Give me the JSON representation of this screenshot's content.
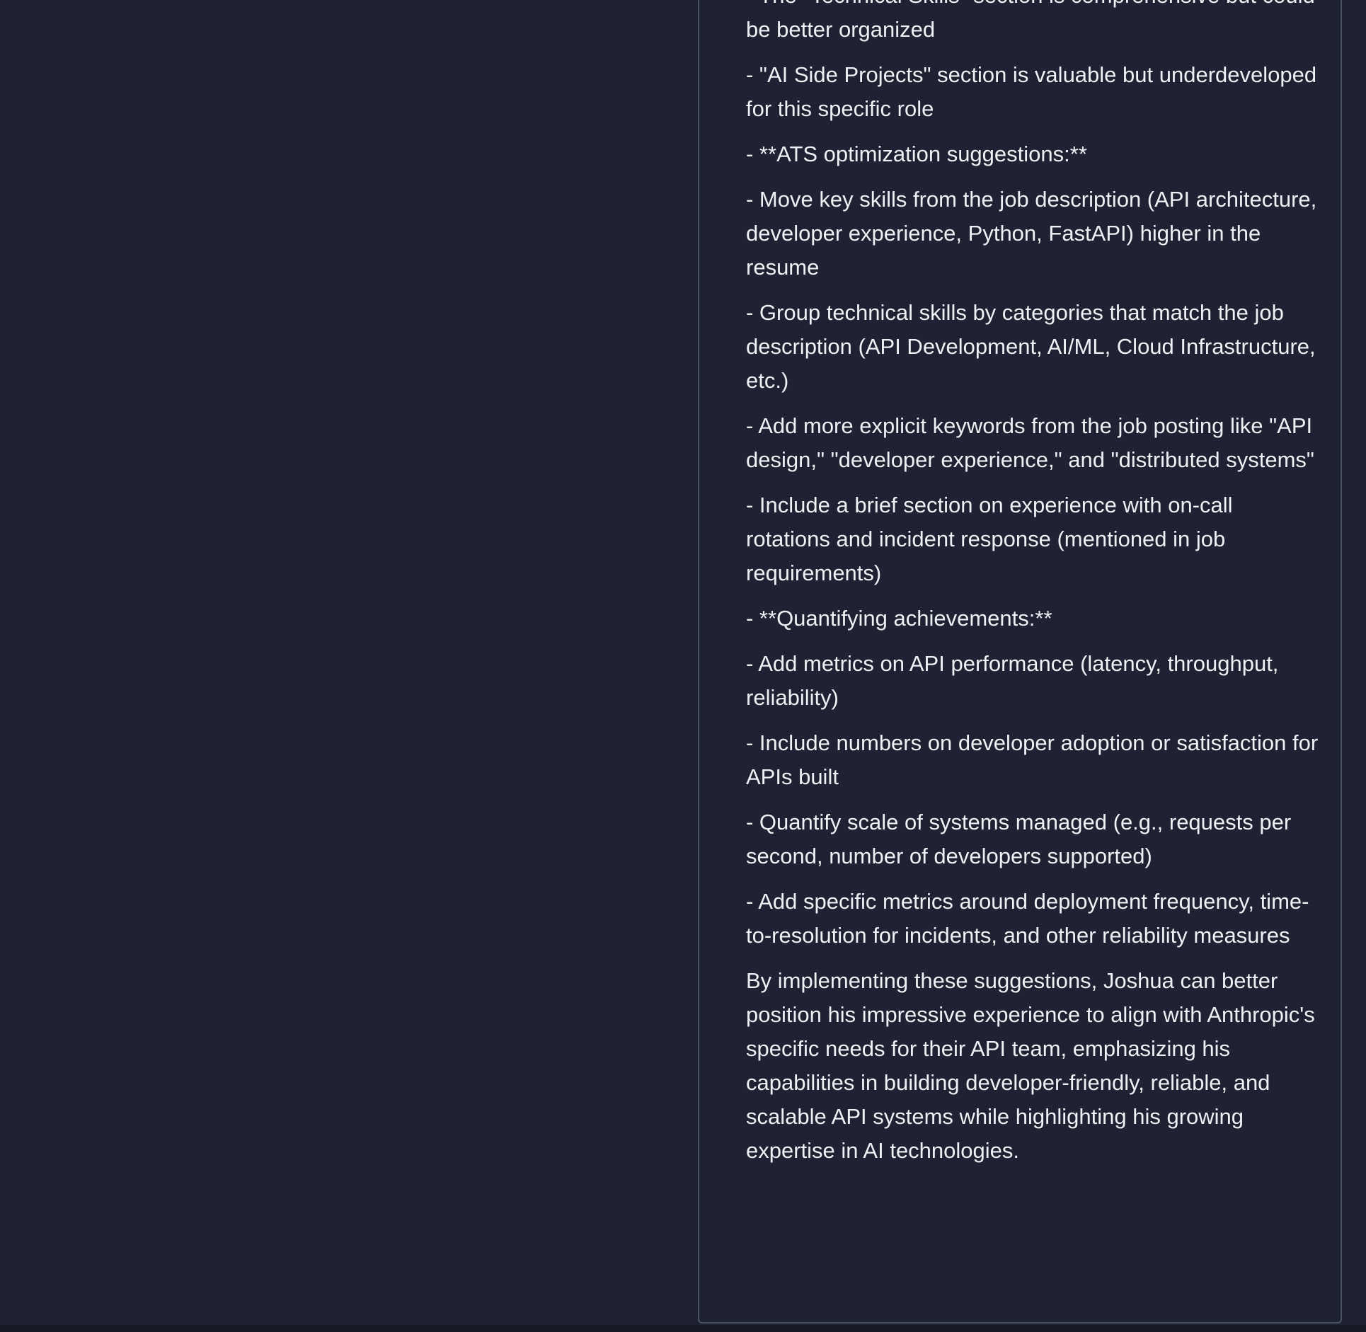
{
  "output": {
    "paragraphs": [
      "- The \"Technical Skills\" section is comprehensive but could be better organized",
      "- \"AI Side Projects\" section is valuable but underdeveloped for this specific role",
      "- **ATS optimization suggestions:**",
      "- Move key skills from the job description (API architecture, developer experience, Python, FastAPI) higher in the resume",
      "- Group technical skills by categories that match the job description (API Development, AI/ML, Cloud Infrastructure, etc.)",
      "- Add more explicit keywords from the job posting like \"API design,\" \"developer experience,\" and \"distributed systems\"",
      "- Include a brief section on experience with on-call rotations and incident response (mentioned in job requirements)",
      "- **Quantifying achievements:**",
      "- Add metrics on API performance (latency, throughput, reliability)",
      "- Include numbers on developer adoption or satisfaction for APIs built",
      "- Quantify scale of systems managed (e.g., requests per second, number of developers supported)",
      "- Add specific metrics around deployment frequency, time-to-resolution for incidents, and other reliability measures",
      "By implementing these suggestions, Joshua can better position his impressive experience to align with Anthropic's specific needs for their API team, emphasizing his capabilities in building developer-friendly, reliable, and scalable API systems while highlighting his growing expertise in AI technologies."
    ]
  }
}
